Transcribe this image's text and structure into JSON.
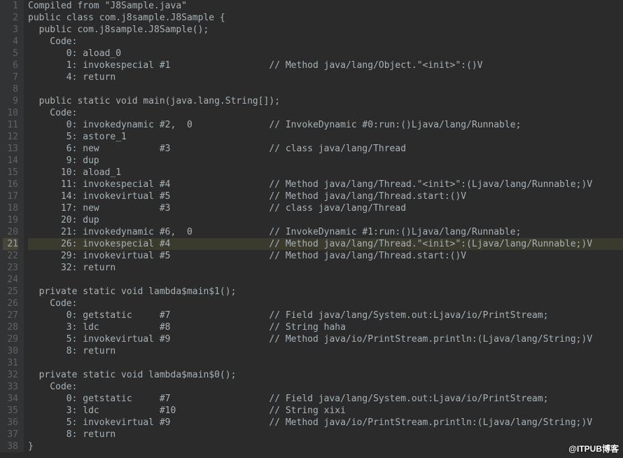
{
  "highlighted_line": 21,
  "watermark": "@ITPUB博客",
  "lines": [
    "Compiled from \"J8Sample.java\"",
    "public class com.j8sample.J8Sample {",
    "  public com.j8sample.J8Sample();",
    "    Code:",
    "       0: aload_0",
    "       1: invokespecial #1                  // Method java/lang/Object.\"<init>\":()V",
    "       4: return",
    "",
    "  public static void main(java.lang.String[]);",
    "    Code:",
    "       0: invokedynamic #2,  0              // InvokeDynamic #0:run:()Ljava/lang/Runnable;",
    "       5: astore_1",
    "       6: new           #3                  // class java/lang/Thread",
    "       9: dup",
    "      10: aload_1",
    "      11: invokespecial #4                  // Method java/lang/Thread.\"<init>\":(Ljava/lang/Runnable;)V",
    "      14: invokevirtual #5                  // Method java/lang/Thread.start:()V",
    "      17: new           #3                  // class java/lang/Thread",
    "      20: dup",
    "      21: invokedynamic #6,  0              // InvokeDynamic #1:run:()Ljava/lang/Runnable;",
    "      26: invokespecial #4                  // Method java/lang/Thread.\"<init>\":(Ljava/lang/Runnable;)V",
    "      29: invokevirtual #5                  // Method java/lang/Thread.start:()V",
    "      32: return",
    "",
    "  private static void lambda$main$1();",
    "    Code:",
    "       0: getstatic     #7                  // Field java/lang/System.out:Ljava/io/PrintStream;",
    "       3: ldc           #8                  // String haha",
    "       5: invokevirtual #9                  // Method java/io/PrintStream.println:(Ljava/lang/String;)V",
    "       8: return",
    "",
    "  private static void lambda$main$0();",
    "    Code:",
    "       0: getstatic     #7                  // Field java/lang/System.out:Ljava/io/PrintStream;",
    "       3: ldc           #10                 // String xixi",
    "       5: invokevirtual #9                  // Method java/io/PrintStream.println:(Ljava/lang/String;)V",
    "       8: return",
    "}"
  ]
}
